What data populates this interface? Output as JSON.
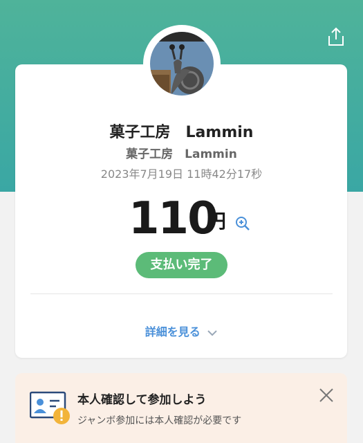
{
  "header": {
    "share_icon": "share-icon",
    "background_color": "#4fb39a"
  },
  "receipt": {
    "merchant_name": "菓子工房　Lammin",
    "merchant_subname": "菓子工房　Lammin",
    "datetime": "2023年7月19日 11時42分17秒",
    "amount": "110",
    "currency": "円",
    "zoom_icon": "zoom-in-icon",
    "status": "支払い完了",
    "status_color": "#5cbb78",
    "details_label": "詳細を見る"
  },
  "banner": {
    "title": "本人確認して参加しよう",
    "text": "ジャンボ参加には本人確認が必要です",
    "close_icon": "close-icon",
    "background_color": "#fbefe6"
  }
}
